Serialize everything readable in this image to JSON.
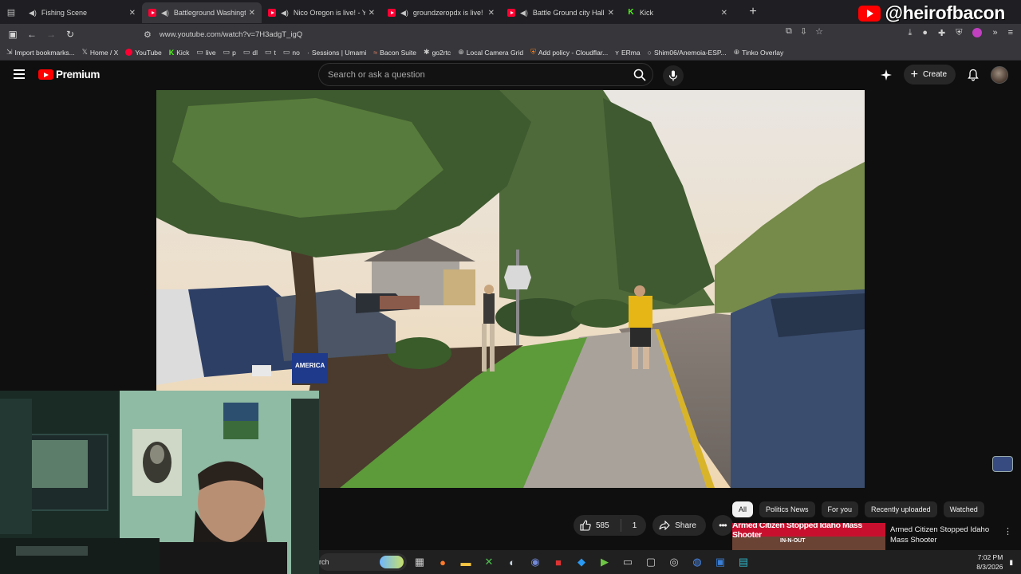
{
  "browser": {
    "tabs": [
      {
        "title": "Fishing Scene",
        "icon": "audio",
        "active": false
      },
      {
        "title": "Battleground Washington",
        "icon": "youtube",
        "active": true
      },
      {
        "title": "Nico Oregon is live! - YouT",
        "icon": "youtube",
        "active": false
      },
      {
        "title": "groundzeropdx is live! - You",
        "icon": "youtube",
        "active": false
      },
      {
        "title": "Battle Ground city Hall - Yo",
        "icon": "youtube",
        "active": false
      },
      {
        "title": "Kick",
        "icon": "kick",
        "active": false
      }
    ],
    "url": "www.youtube.com/watch?v=7H3adgT_igQ",
    "bookmarks": [
      {
        "label": "Import bookmarks...",
        "icon": "bookmark-import"
      },
      {
        "label": "Home / X",
        "icon": "x"
      },
      {
        "label": "YouTube",
        "icon": "youtube"
      },
      {
        "label": "Kick",
        "icon": "kick"
      },
      {
        "label": "live",
        "icon": "folder"
      },
      {
        "label": "p",
        "icon": "folder"
      },
      {
        "label": "dl",
        "icon": "folder"
      },
      {
        "label": "t",
        "icon": "folder"
      },
      {
        "label": "no",
        "icon": "folder"
      },
      {
        "label": "Sessions | Umami",
        "icon": "umami"
      },
      {
        "label": "Bacon Suite",
        "icon": "bacon"
      },
      {
        "label": "go2rtc",
        "icon": "go2rtc"
      },
      {
        "label": "Local Camera Grid",
        "icon": "globe"
      },
      {
        "label": "Add policy - Cloudflar...",
        "icon": "shield"
      },
      {
        "label": "ERma",
        "icon": "erma"
      },
      {
        "label": "Shim06/Anemoia-ESP...",
        "icon": "github"
      },
      {
        "label": "Tinko Overlay",
        "icon": "globe"
      }
    ]
  },
  "overlay": {
    "handle": "@heirofbacon"
  },
  "youtube": {
    "logo_text": "Premium",
    "search_placeholder": "Search or ask a question",
    "create_label": "Create",
    "likes": "585",
    "dislikes": "1",
    "share_label": "Share",
    "chips": [
      {
        "label": "All",
        "active": true
      },
      {
        "label": "Politics News",
        "active": false
      },
      {
        "label": "For you",
        "active": false
      },
      {
        "label": "Recently uploaded",
        "active": false
      },
      {
        "label": "Watched",
        "active": false
      }
    ],
    "recommendation": {
      "thumbnail_banner": "Armed Citizen Stopped Idaho Mass Shooter",
      "thumbnail_sub": "IN-N-OUT",
      "title": "Armed Citizen Stopped Idaho Mass Shooter"
    }
  },
  "video_scene": {
    "sign_text": "AMERICA"
  },
  "taskbar": {
    "search_text": "rch",
    "time": "7:02 PM",
    "date": "8/3/2026"
  },
  "colors": {
    "yt_red": "#ff0000",
    "kick_green": "#53fc18",
    "background": "#0f0f0f"
  }
}
